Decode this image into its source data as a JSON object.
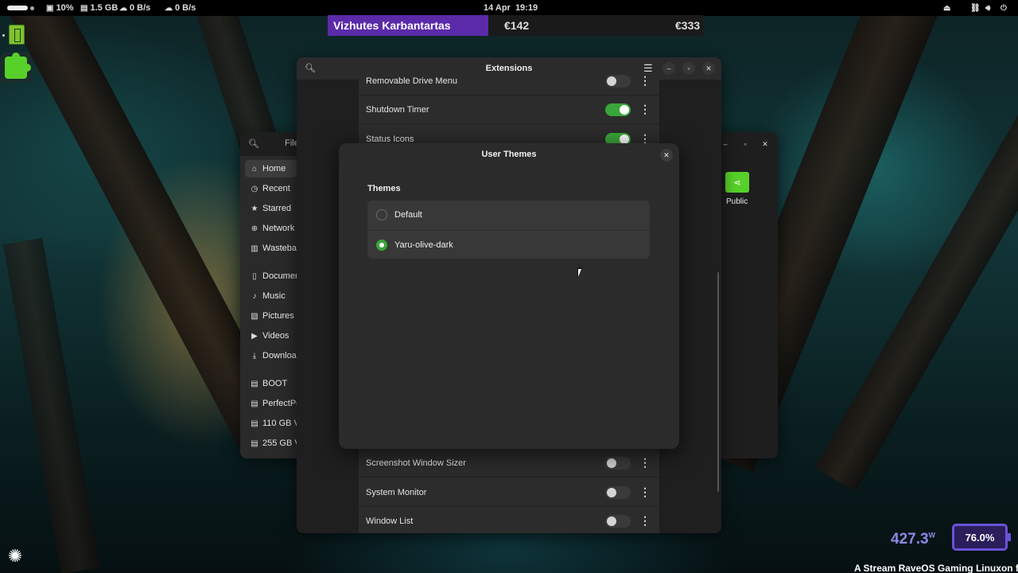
{
  "topbar": {
    "cpu": "10%",
    "memory": "1.5 GB",
    "download": "0 B/s",
    "upload": "0 B/s",
    "clock": "14 Apr  19:19"
  },
  "ticker": {
    "name": "Vizhutes Karbantartas",
    "value1": "€142",
    "value2": "€333"
  },
  "files": {
    "title": "File",
    "sidebar": [
      {
        "label": "Home",
        "icon": "home-icon"
      },
      {
        "label": "Recent",
        "icon": "clock-icon"
      },
      {
        "label": "Starred",
        "icon": "star-icon"
      },
      {
        "label": "Network",
        "icon": "network-icon"
      },
      {
        "label": "Wastebas",
        "icon": "trash-icon"
      },
      {
        "label": "Documer",
        "icon": "document-icon"
      },
      {
        "label": "Music",
        "icon": "music-icon"
      },
      {
        "label": "Pictures",
        "icon": "pictures-icon"
      },
      {
        "label": "Videos",
        "icon": "video-icon"
      },
      {
        "label": "Downloa",
        "icon": "download-icon"
      },
      {
        "label": "BOOT",
        "icon": "drive-icon"
      },
      {
        "label": "PerfectPe",
        "icon": "drive-icon"
      },
      {
        "label": "110 GB Vo",
        "icon": "drive-icon"
      },
      {
        "label": "255 GB V",
        "icon": "drive-icon"
      }
    ],
    "public_folder": "Public"
  },
  "extensions": {
    "title": "Extensions",
    "rows": [
      {
        "name": "Removable Drive Menu",
        "enabled": false
      },
      {
        "name": "Shutdown Timer",
        "enabled": true
      },
      {
        "name": "Status Icons",
        "enabled": true
      },
      {
        "name": "Screenshot Window Sizer",
        "enabled": false
      },
      {
        "name": "System Monitor",
        "enabled": false
      },
      {
        "name": "Window List",
        "enabled": false
      }
    ]
  },
  "dialog": {
    "title": "User Themes",
    "heading": "Themes",
    "themes": [
      {
        "label": "Default",
        "selected": false
      },
      {
        "label": "Yaru-olive-dark",
        "selected": true
      }
    ]
  },
  "widgets": {
    "power": "427.3",
    "power_unit": "W",
    "battery": "76.0%",
    "marquee": "A Stream RaveOS Gaming Linuxon fut"
  },
  "colors": {
    "accent": "#3aa53a",
    "ticker_highlight": "#5b2aa8",
    "battery": "#6a52d8"
  }
}
